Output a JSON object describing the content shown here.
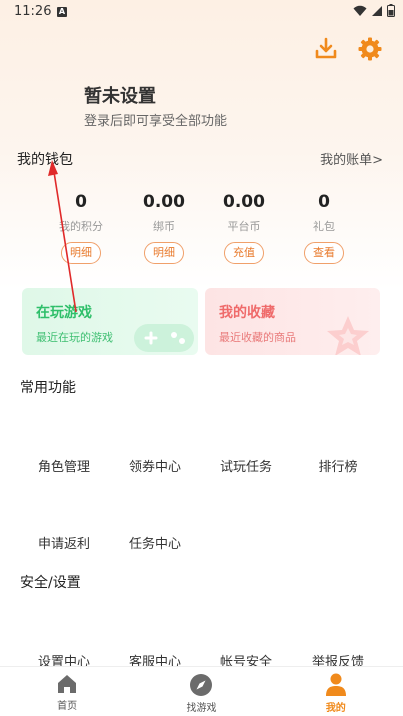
{
  "status_bar": {
    "time": "11:26",
    "notif": "A"
  },
  "header": {
    "download_icon": "download-icon",
    "settings_icon": "gear-icon"
  },
  "profile": {
    "name": "暂未设置",
    "subtitle": "登录后即可享受全部功能"
  },
  "wallet": {
    "title": "我的钱包",
    "bill_link": "我的账单>",
    "stats": [
      {
        "value": "0",
        "label": "我的积分",
        "button": "明细"
      },
      {
        "value": "0.00",
        "label": "绑币",
        "button": "明细"
      },
      {
        "value": "0.00",
        "label": "平台币",
        "button": "充值"
      },
      {
        "value": "0",
        "label": "礼包",
        "button": "查看"
      }
    ]
  },
  "cards": {
    "playing": {
      "title": "在玩游戏",
      "subtitle": "最近在玩的游戏"
    },
    "favorites": {
      "title": "我的收藏",
      "subtitle": "最近收藏的商品"
    }
  },
  "common": {
    "title": "常用功能",
    "items": [
      "角色管理",
      "领券中心",
      "试玩任务",
      "排行榜",
      "申请返利",
      "任务中心"
    ]
  },
  "security": {
    "title": "安全/设置",
    "items": [
      "设置中心",
      "客服中心",
      "帐号安全",
      "举报反馈"
    ]
  },
  "nav": {
    "items": [
      {
        "label": "首页",
        "icon": "home-icon"
      },
      {
        "label": "找游戏",
        "icon": "compass-icon"
      },
      {
        "label": "我的",
        "icon": "user-icon"
      }
    ],
    "active": "我的"
  },
  "colors": {
    "accent": "#f08a1c",
    "green": "#2fbf6a",
    "red": "#ef6a6a",
    "annotation": "#e02a2a"
  }
}
